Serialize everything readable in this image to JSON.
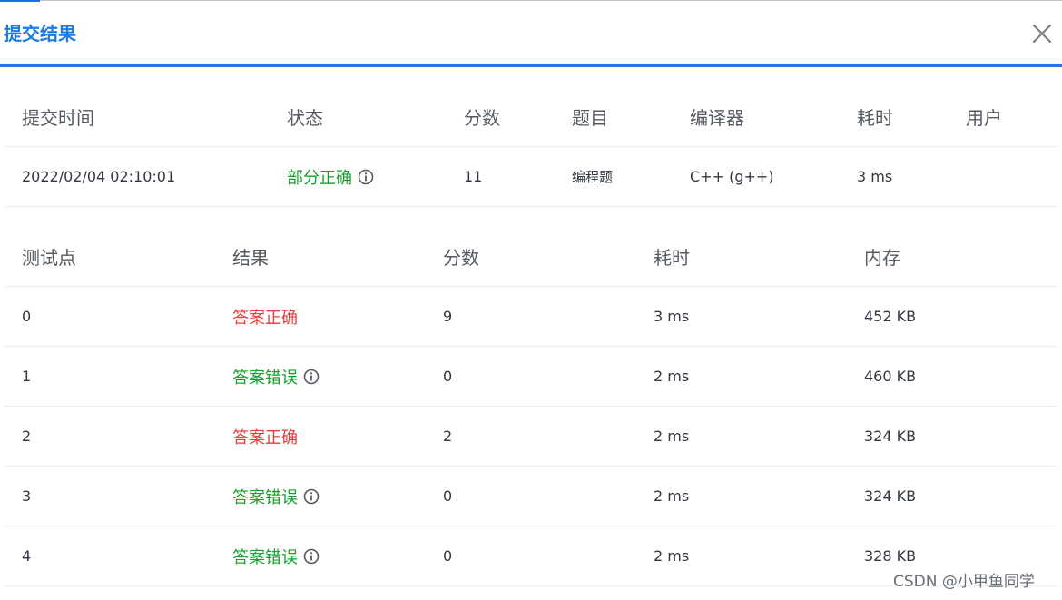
{
  "dialog": {
    "title": "提交结果",
    "close_label": "×"
  },
  "submission": {
    "headers": [
      "提交时间",
      "状态",
      "分数",
      "题目",
      "编译器",
      "耗时",
      "用户"
    ],
    "row": {
      "time": "2022/02/04 02:10:01",
      "status": "部分正确",
      "score": "11",
      "problem": "编程题",
      "compiler": "C++ (g++)",
      "elapsed": "3 ms",
      "user": ""
    }
  },
  "testcases": {
    "headers": [
      "测试点",
      "结果",
      "分数",
      "耗时",
      "内存"
    ],
    "rows": [
      {
        "id": "0",
        "result": "答案正确",
        "result_type": "correct",
        "score": "9",
        "time": "3 ms",
        "memory": "452 KB"
      },
      {
        "id": "1",
        "result": "答案错误",
        "result_type": "wrong",
        "score": "0",
        "time": "2 ms",
        "memory": "460 KB"
      },
      {
        "id": "2",
        "result": "答案正确",
        "result_type": "correct",
        "score": "2",
        "time": "2 ms",
        "memory": "324 KB"
      },
      {
        "id": "3",
        "result": "答案错误",
        "result_type": "wrong",
        "score": "0",
        "time": "2 ms",
        "memory": "324 KB"
      },
      {
        "id": "4",
        "result": "答案错误",
        "result_type": "wrong",
        "score": "0",
        "time": "2 ms",
        "memory": "328 KB"
      }
    ]
  },
  "watermark": "CSDN @小甲鱼同学",
  "colors": {
    "accent": "#1e7be0",
    "correct": "#e63c3c",
    "wrong": "#17a12e",
    "partial": "#17a12e"
  },
  "icons": {
    "info": "info-circle-icon",
    "close": "close-icon"
  }
}
